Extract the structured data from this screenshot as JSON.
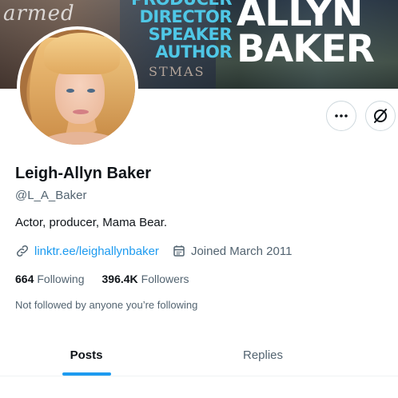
{
  "banner": {
    "script_text": "armed",
    "roles_text": "PRODUCER\nDIRECTOR\nSPEAKER\nAUTHOR",
    "name_line1": "ALLYN",
    "name_line2": "BAKER",
    "poster_text": "STMAS"
  },
  "profile": {
    "display_name": "Leigh-Allyn Baker",
    "handle": "@L_A_Baker",
    "bio": "Actor, producer, Mama Bear.",
    "link": "linktr.ee/leighallynbaker",
    "joined": "Joined March 2011",
    "following_count": "664",
    "following_label": "Following",
    "followers_count": "396.4K",
    "followers_label": "Followers",
    "not_followed": "Not followed by anyone you’re following"
  },
  "tabs": [
    {
      "label": "Posts",
      "selected": true
    },
    {
      "label": "Replies",
      "selected": false
    }
  ],
  "icons": {
    "more": "more-horizontal-icon",
    "subscribe": "subscribe-icon",
    "link": "link-icon",
    "calendar": "calendar-icon"
  },
  "colors": {
    "accent": "#1d9bf0",
    "text": "#0f1419",
    "secondary": "#536471",
    "border": "#cfd9de"
  }
}
